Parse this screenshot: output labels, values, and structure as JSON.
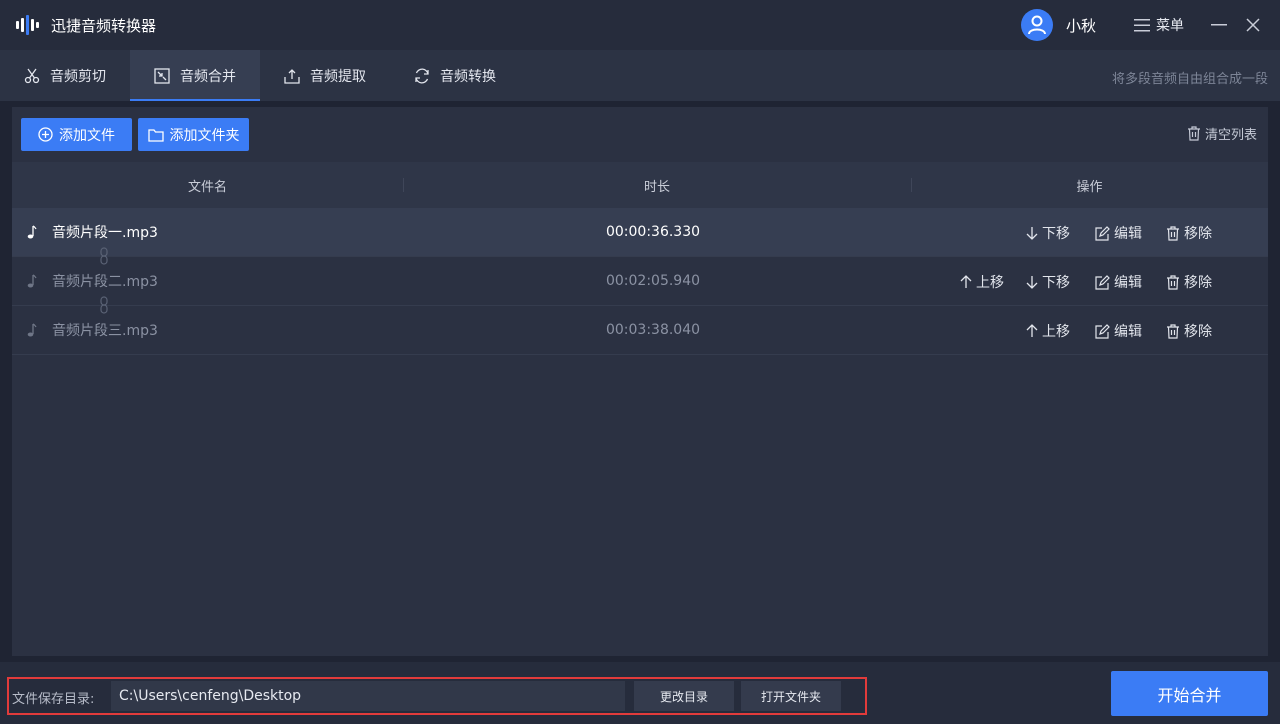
{
  "app": {
    "title": "迅捷音频转换器",
    "username": "小秋",
    "menu_label": "菜单"
  },
  "tabs": [
    {
      "label": "音频剪切",
      "icon": "scissors-icon",
      "active": false
    },
    {
      "label": "音频合并",
      "icon": "merge-icon",
      "active": true
    },
    {
      "label": "音频提取",
      "icon": "upload-icon",
      "active": false
    },
    {
      "label": "音频转换",
      "icon": "refresh-icon",
      "active": false
    }
  ],
  "tab_hint": "将多段音频自由组合成一段",
  "toolbar": {
    "add_file": "添加文件",
    "add_folder": "添加文件夹",
    "clear_list": "清空列表"
  },
  "table": {
    "headers": {
      "name": "文件名",
      "duration": "时长",
      "actions": "操作"
    },
    "rows": [
      {
        "name": "音频片段一.mp3",
        "duration": "00:00:36.330",
        "selected": true
      },
      {
        "name": "音频片段二.mp3",
        "duration": "00:02:05.940",
        "selected": false
      },
      {
        "name": "音频片段三.mp3",
        "duration": "00:03:38.040",
        "selected": false
      }
    ],
    "actions": {
      "up": "上移",
      "down": "下移",
      "edit": "编辑",
      "remove": "移除"
    }
  },
  "bottom": {
    "save_dir_label": "文件保存目录:",
    "save_dir_value": "C:\\Users\\cenfeng\\Desktop",
    "change_dir": "更改目录",
    "open_folder": "打开文件夹",
    "start_merge": "开始合并"
  },
  "colors": {
    "accent": "#3b7cf5",
    "highlight_border": "#e23b3b"
  }
}
